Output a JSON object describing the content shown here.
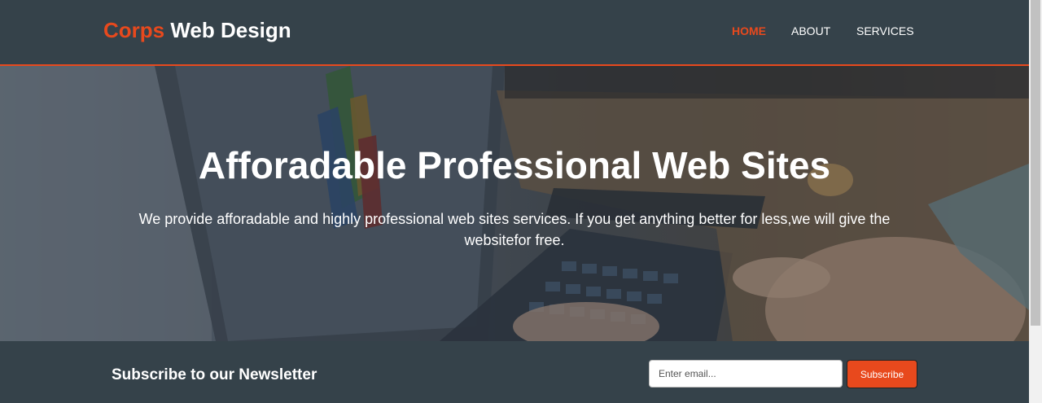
{
  "header": {
    "brand_highlight": "Corps",
    "brand_rest": " Web Design",
    "nav": {
      "home": "HOME",
      "about": "ABOUT",
      "services": "SERVICES"
    },
    "active_nav": "home"
  },
  "showcase": {
    "title": "Afforadable Professional Web Sites",
    "text": "We provide afforadable and highly professional web sites services. If you get anything better for less,we will give the websitefor free."
  },
  "newsletter": {
    "heading": "Subscribe to our Newsletter",
    "email_placeholder": "Enter email...",
    "email_value": "",
    "button_label": "Subscribe"
  },
  "colors": {
    "accent": "#e8491d",
    "header_bg": "#35424a",
    "text_light": "#ffffff"
  }
}
